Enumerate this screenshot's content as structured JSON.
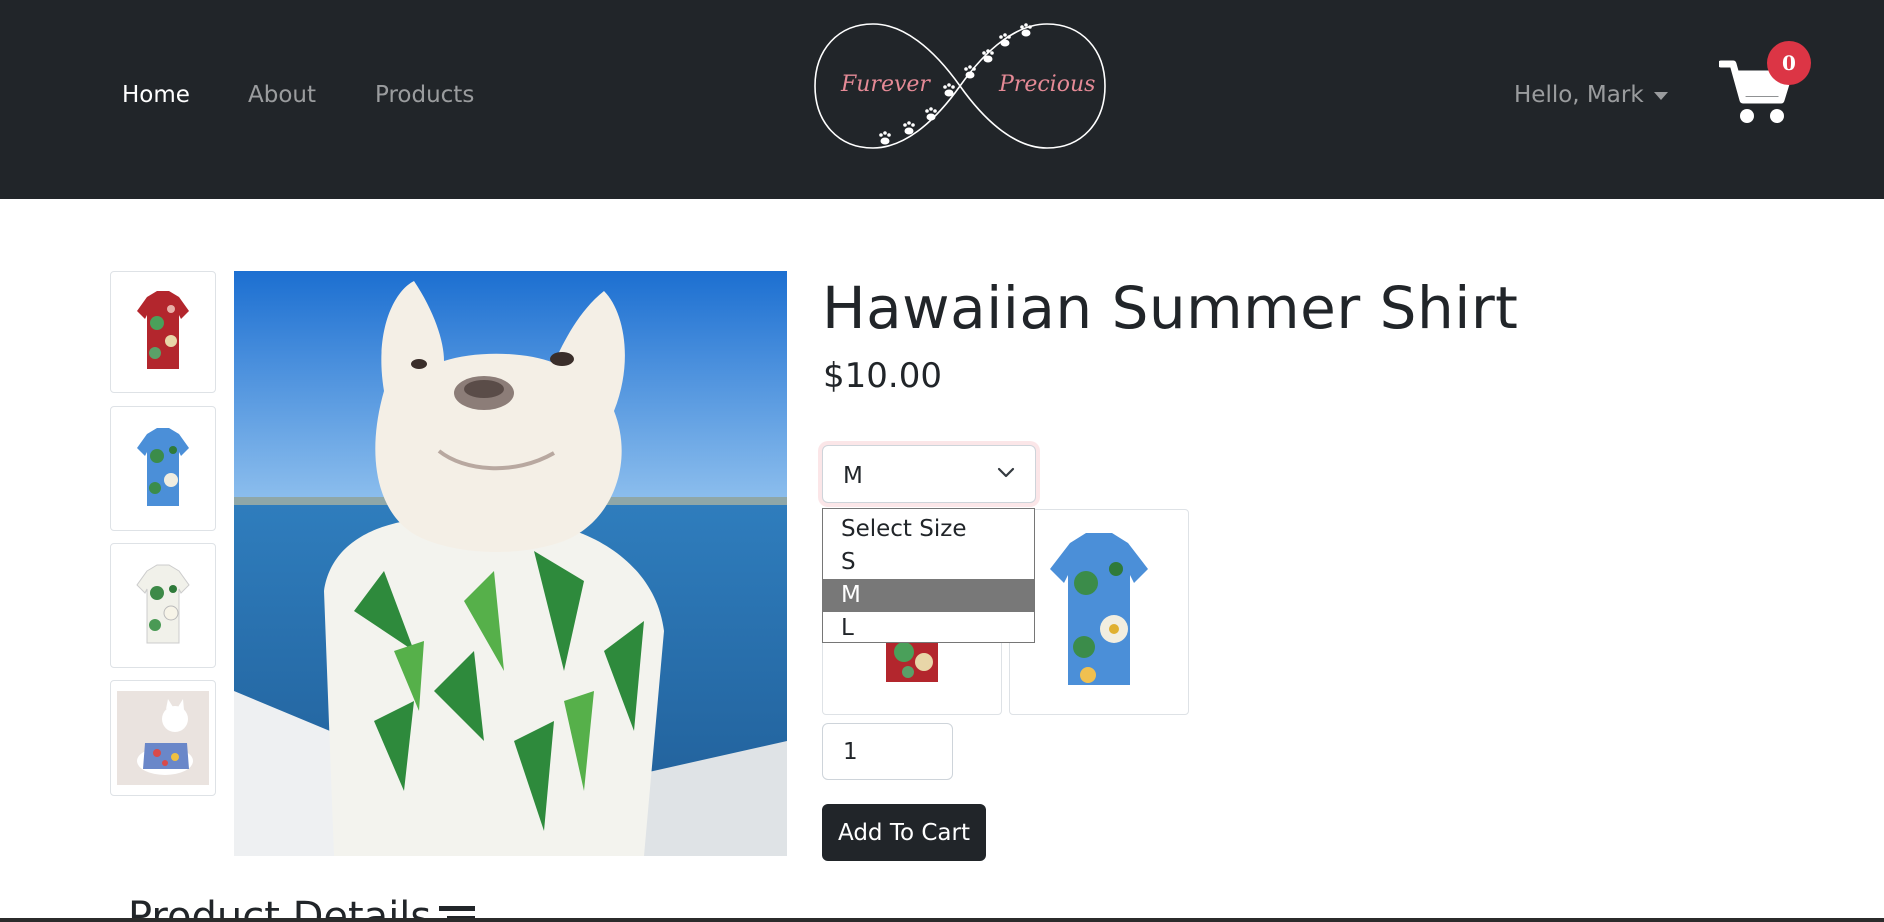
{
  "nav": {
    "links": [
      "Home",
      "About",
      "Products"
    ],
    "brand": {
      "word1": "Furever",
      "word2": "Precious"
    },
    "user_greeting": "Hello, Mark",
    "cart_count": "0"
  },
  "product": {
    "title": "Hawaiian Summer Shirt",
    "price": "$10.00",
    "size_selected": "M",
    "size_options": [
      "Select Size",
      "S",
      "M",
      "L"
    ],
    "quantity": "1",
    "add_to_cart_label": "Add To Cart",
    "details_heading": "Product Details"
  },
  "colors": {
    "navbar": "#212529",
    "badge": "#dc3545",
    "brand_text": "#e58a96",
    "selected_option": "#787878"
  },
  "icons": [
    "paw-icon",
    "cart-icon",
    "chevron-down-icon",
    "list-icon"
  ]
}
